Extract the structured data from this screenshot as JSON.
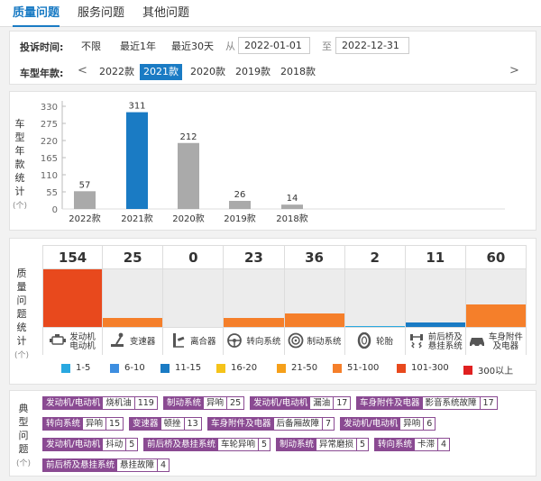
{
  "tabs": [
    "质量问题",
    "服务问题",
    "其他问题"
  ],
  "filter": {
    "time_label": "投诉时间:",
    "time_options": [
      "不限",
      "最近1年",
      "最近30天"
    ],
    "from_label": "从",
    "from_date": "2022-01-01",
    "to_label": "至",
    "to_date": "2022-12-31",
    "model_year_label": "车型年款:",
    "prev": "<",
    "next": ">",
    "years": [
      "2022款",
      "2021款",
      "2020款",
      "2019款",
      "2018款"
    ],
    "selected_year": "2021款"
  },
  "stats_label": {
    "chars": [
      "车",
      "型",
      "年",
      "款",
      "统",
      "计"
    ],
    "unit": "(个)"
  },
  "chart_data": {
    "type": "bar",
    "categories": [
      "2022款",
      "2021款",
      "2020款",
      "2019款",
      "2018款"
    ],
    "values": [
      57,
      311,
      212,
      26,
      14
    ],
    "highlight": "2021款",
    "yticks": [
      0,
      55,
      110,
      165,
      220,
      275,
      330
    ],
    "ylim": [
      0,
      330
    ],
    "colors": {
      "default": "#aaaaaa",
      "highlight": "#1a7bc4"
    }
  },
  "quality_label": {
    "chars": [
      "质",
      "量",
      "问",
      "题",
      "统",
      "计"
    ],
    "unit": "(个)"
  },
  "quality": {
    "max": 154,
    "items": [
      {
        "count": "154",
        "value": 154,
        "name": "发动机\n电动机",
        "icon": "engine-icon",
        "color": "#e8491d"
      },
      {
        "count": "25",
        "value": 25,
        "name": "变速器",
        "icon": "gearshift-icon",
        "color": "#f57f2a"
      },
      {
        "count": "0",
        "value": 0,
        "name": "离合器",
        "icon": "clutch-pedal-icon",
        "color": "#f57f2a"
      },
      {
        "count": "23",
        "value": 23,
        "name": "转向系统",
        "icon": "steering-wheel-icon",
        "color": "#f57f2a"
      },
      {
        "count": "36",
        "value": 36,
        "name": "制动系统",
        "icon": "brake-disc-icon",
        "color": "#f57f2a"
      },
      {
        "count": "2",
        "value": 2,
        "name": "轮胎",
        "icon": "tire-icon",
        "color": "#29a8e0"
      },
      {
        "count": "11",
        "value": 11,
        "name": "前后桥及\n悬挂系统",
        "icon": "suspension-icon",
        "color": "#1a7bc4"
      },
      {
        "count": "60",
        "value": 60,
        "name": "车身附件\n及电器",
        "icon": "car-body-icon",
        "color": "#f57f2a"
      }
    ]
  },
  "legend": [
    {
      "label": "1-5",
      "color": "#29a8e0"
    },
    {
      "label": "6-10",
      "color": "#3d8ee0"
    },
    {
      "label": "11-15",
      "color": "#1a7bc4"
    },
    {
      "label": "16-20",
      "color": "#f5c31a"
    },
    {
      "label": "21-50",
      "color": "#f5a01a"
    },
    {
      "label": "51-100",
      "color": "#f57f2a"
    },
    {
      "label": "101-300",
      "color": "#e8491d"
    },
    {
      "label": "300以上",
      "color": "#e02020"
    }
  ],
  "typical_label": {
    "chars": [
      "典",
      "型",
      "问",
      "题"
    ],
    "unit": "(个)"
  },
  "tags": [
    [
      {
        "system": "发动机/电动机",
        "issue": "烧机油",
        "count": "119"
      },
      {
        "system": "制动系统",
        "issue": "异响",
        "count": "25"
      },
      {
        "system": "发动机/电动机",
        "issue": "漏油",
        "count": "17"
      },
      {
        "system": "车身附件及电器",
        "issue": "影音系统故障",
        "count": "17"
      }
    ],
    [
      {
        "system": "转向系统",
        "issue": "异响",
        "count": "15"
      },
      {
        "system": "变速器",
        "issue": "顿挫",
        "count": "13"
      },
      {
        "system": "车身附件及电器",
        "issue": "后备厢故障",
        "count": "7"
      },
      {
        "system": "发动机/电动机",
        "issue": "异响",
        "count": "6"
      }
    ],
    [
      {
        "system": "发动机/电动机",
        "issue": "抖动",
        "count": "5"
      },
      {
        "system": "前后桥及悬挂系统",
        "issue": "车轮异响",
        "count": "5"
      },
      {
        "system": "制动系统",
        "issue": "异常磨损",
        "count": "5"
      },
      {
        "system": "转向系统",
        "issue": "卡滞",
        "count": "4"
      }
    ],
    [
      {
        "system": "前后桥及悬挂系统",
        "issue": "悬挂故障",
        "count": "4"
      }
    ]
  ]
}
